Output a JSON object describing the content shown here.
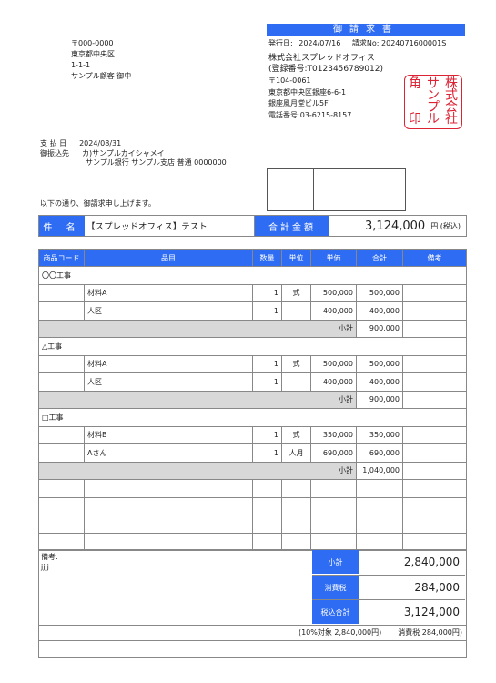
{
  "doc_title": "御請求書",
  "recipient": {
    "postal": "〒000-0000",
    "address1": "東京都中央区",
    "address2": "1-1-1",
    "name": "サンプル顧客 御中"
  },
  "issue": {
    "issue_date_label": "発行日:",
    "issue_date": "2024/07/16",
    "invoice_no_label": "請求No:",
    "invoice_no": "2024071600001S"
  },
  "issuer": {
    "company": "株式会社スプレッドオフィス",
    "registration": "(登録番号:T0123456789012)",
    "postal": "〒104-0061",
    "address1": "東京都中央区銀座6-6-1",
    "address2": "銀座風月堂ビル5F",
    "phone": "電話番号:03-6215-8157"
  },
  "stamp": [
    "株",
    "式",
    "会",
    "社",
    "サ",
    "ン",
    "プ",
    "ル",
    "角",
    "印"
  ],
  "payment": {
    "date_label": "支 払 日",
    "date": "2024/08/31",
    "account_label": "御振込先",
    "account_name": "カ)サンプルカイシャメイ",
    "account_bank": "サンプル銀行 サンプル支店 普通 0000000"
  },
  "intro": "以下の通り、御請求申し上げます。",
  "subject": {
    "label": "件 名",
    "value": "【スプレッドオフィス】テスト",
    "total_label": "合計金額",
    "total": "3,124,000",
    "tax_suffix": "円 (税込)"
  },
  "table": {
    "headers": [
      "商品コード",
      "品目",
      "数量",
      "単位",
      "単価",
      "合計",
      "備考"
    ],
    "sections": [
      {
        "title": "〇〇工事",
        "rows": [
          {
            "code": "",
            "item": "材料A",
            "qty": "1",
            "unit": "式",
            "price": "500,000",
            "total": "500,000",
            "note": ""
          },
          {
            "code": "",
            "item": "人区",
            "qty": "1",
            "unit": "",
            "price": "400,000",
            "total": "400,000",
            "note": ""
          }
        ],
        "subtotal_label": "小計",
        "subtotal": "900,000"
      },
      {
        "title": "△工事",
        "rows": [
          {
            "code": "",
            "item": "材料A",
            "qty": "1",
            "unit": "式",
            "price": "500,000",
            "total": "500,000",
            "note": ""
          },
          {
            "code": "",
            "item": "人区",
            "qty": "1",
            "unit": "",
            "price": "400,000",
            "total": "400,000",
            "note": ""
          }
        ],
        "subtotal_label": "小計",
        "subtotal": "900,000"
      },
      {
        "title": "□工事",
        "rows": [
          {
            "code": "",
            "item": "材料B",
            "qty": "1",
            "unit": "式",
            "price": "350,000",
            "total": "350,000",
            "note": ""
          },
          {
            "code": "",
            "item": "Aさん",
            "qty": "1",
            "unit": "人月",
            "price": "690,000",
            "total": "690,000",
            "note": ""
          }
        ],
        "subtotal_label": "小計",
        "subtotal": "1,040,000"
      }
    ],
    "empty_rows": 4
  },
  "notes": {
    "label": "備考:",
    "text": "jjjj"
  },
  "totals": [
    {
      "label": "小計",
      "value": "2,840,000"
    },
    {
      "label": "消費税",
      "value": "284,000"
    },
    {
      "label": "税込合計",
      "value": "3,124,000"
    }
  ],
  "tax_breakdown": {
    "target": "(10%対象 2,840,000円)",
    "tax": "消費税 284,000円)"
  }
}
